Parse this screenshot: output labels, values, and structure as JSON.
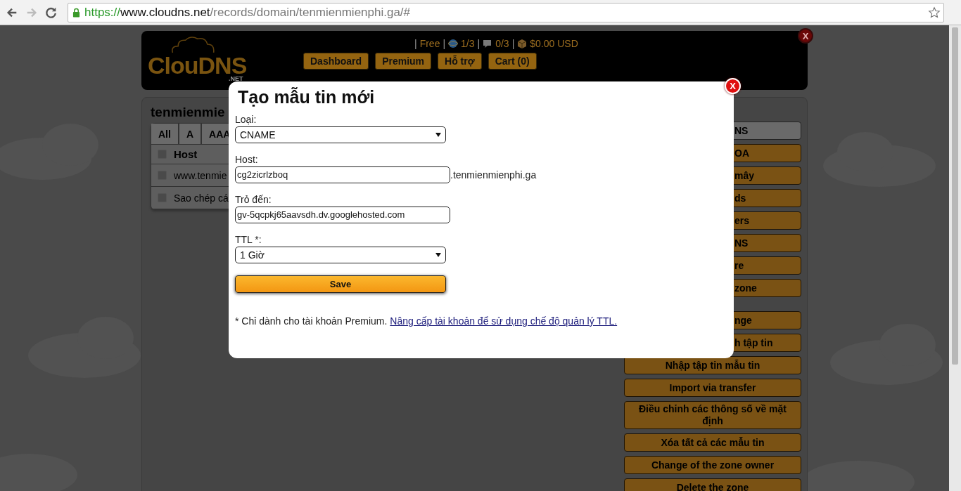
{
  "browser": {
    "url": {
      "scheme": "https://",
      "host": "www.cloudns.net",
      "path": "/records/domain/tenmienmienphi.ga/#"
    }
  },
  "header": {
    "logo": "ClouDNS",
    "logo_sub": ".NET",
    "stats": [
      {
        "kind": "sep",
        "text": "|"
      },
      {
        "kind": "plan",
        "text": "Free"
      },
      {
        "kind": "sep",
        "text": "|"
      },
      {
        "kind": "globe",
        "text": "1/3"
      },
      {
        "kind": "sep",
        "text": "|"
      },
      {
        "kind": "chat",
        "text": "0/3"
      },
      {
        "kind": "sep",
        "text": "|"
      },
      {
        "kind": "box",
        "text": "$0.00 USD"
      }
    ],
    "nav": [
      {
        "label": "Dashboard"
      },
      {
        "label": "Premium"
      },
      {
        "label": "Hỗ trợ"
      },
      {
        "label": "Cart (0)"
      }
    ],
    "close": "X"
  },
  "zone": {
    "title": "tenmienmie",
    "tabs": [
      "All",
      "A",
      "AAA"
    ],
    "columns": [
      {
        "label": "Host",
        "checked": false
      }
    ],
    "rows": [
      {
        "host": "www.tenmie",
        "checked": false
      },
      {
        "host": "Sao chép cá",
        "checked": false
      }
    ]
  },
  "sidebar": [
    {
      "items": [
        {
          "label": "NS",
          "kind": "partial",
          "selected": true
        },
        {
          "label": "OA",
          "kind": "partial",
          "selected": false
        },
        {
          "label": "mây",
          "kind": "partial",
          "selected": false
        },
        {
          "label": "ds",
          "kind": "partial",
          "selected": false
        },
        {
          "label": "ers",
          "kind": "partial",
          "selected": false
        },
        {
          "label": "NS",
          "kind": "partial",
          "selected": false
        },
        {
          "label": "re",
          "kind": "partial",
          "selected": false
        },
        {
          "label": "zone",
          "kind": "partial",
          "selected": false
        }
      ]
    },
    {
      "items": [
        {
          "label": "nge",
          "kind": "partial",
          "selected": false
        },
        {
          "label": "h tập tin",
          "kind": "partial",
          "selected": false
        },
        {
          "label": "Nhập tập tin mẫu tin",
          "kind": "full",
          "selected": false
        },
        {
          "label": "Import via transfer",
          "kind": "full",
          "selected": false
        },
        {
          "label": "Điều chỉnh các thông số về mặt định",
          "kind": "full",
          "selected": false
        },
        {
          "label": "Xóa tất cả các mẫu tin",
          "kind": "full",
          "selected": false
        },
        {
          "label": "Change of the zone owner",
          "kind": "full",
          "selected": false
        },
        {
          "label": "Delete the zone",
          "kind": "full",
          "selected": false
        }
      ]
    }
  ],
  "dialog": {
    "title": "Tạo mẫu tin mới",
    "close": "X",
    "fields": [
      {
        "kind": "select",
        "label": "Loại:",
        "value": "CNAME"
      },
      {
        "kind": "input",
        "label": "Host:",
        "value": "cg2zicrlzboq",
        "suffix": ".tenmienmienphi.ga"
      },
      {
        "kind": "input",
        "label": "Trỏ đến:",
        "value": "gv-5qcpkj65aavsdh.dv.googlehosted.com"
      },
      {
        "kind": "select",
        "label": "TTL *:",
        "value": "1 Giờ"
      }
    ],
    "save": "Save",
    "note": "* Chỉ dành cho tài khoản Premium.",
    "link": "Nâng cấp tài khoản để sử dụng chế độ quản lý TTL."
  }
}
